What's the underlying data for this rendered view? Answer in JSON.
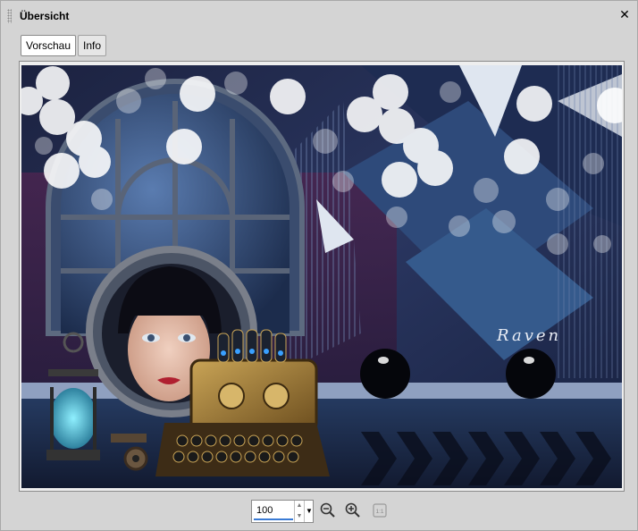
{
  "panel": {
    "title": "Übersicht",
    "close_icon": "close-icon"
  },
  "tabs": [
    {
      "label": "Vorschau",
      "active": true
    },
    {
      "label": "Info",
      "active": false
    }
  ],
  "preview": {
    "signature_text": "Raven"
  },
  "zoom": {
    "value": "100",
    "zoom_out_icon": "zoom-out-icon",
    "zoom_in_icon": "zoom-in-icon",
    "actual_size_icon": "actual-size-icon",
    "actual_size_label": "1:1"
  }
}
